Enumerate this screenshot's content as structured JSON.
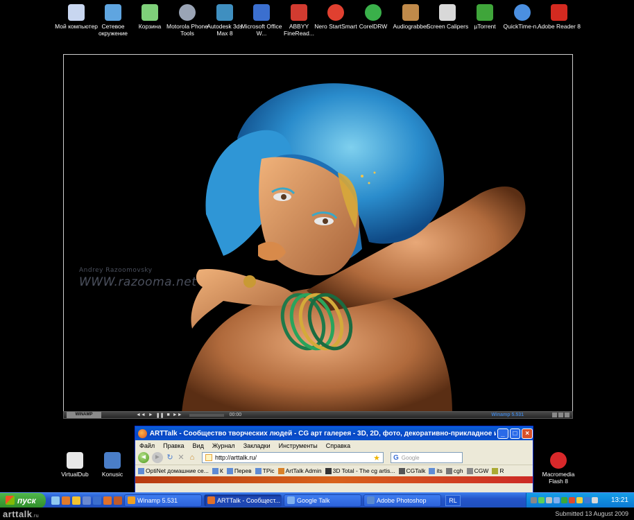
{
  "desktop_icons_top": [
    {
      "label": "Мой компьютер",
      "icon": "my-computer-icon",
      "color": "#c8d6f0"
    },
    {
      "label": "Сетевое окружение",
      "icon": "network-icon",
      "color": "#5fa5e0"
    },
    {
      "label": "Корзина",
      "icon": "recycle-bin-icon",
      "color": "#7fd07a"
    },
    {
      "label": "Motorola Phone Tools",
      "icon": "motorola-icon",
      "color": "#9aa4b5"
    },
    {
      "label": "Autodesk 3ds Max 8",
      "icon": "3dsmax-icon",
      "color": "#3f8fc0"
    },
    {
      "label": "Microsoft Office W...",
      "icon": "word-icon",
      "color": "#3b6fcf"
    },
    {
      "label": "ABBYY FineRead...",
      "icon": "abbyy-icon",
      "color": "#d23b30"
    },
    {
      "label": "Nero StartSmart",
      "icon": "nero-icon",
      "color": "#e04030"
    },
    {
      "label": "CorelDRW",
      "icon": "coreldraw-icon",
      "color": "#3ab04a"
    },
    {
      "label": "Audiograbber",
      "icon": "audiograbber-icon",
      "color": "#c08a4a"
    },
    {
      "label": "Screen Calipers",
      "icon": "screen-calipers-icon",
      "color": "#d8d8d8"
    },
    {
      "label": "µTorrent",
      "icon": "utorrent-icon",
      "color": "#3fa53a"
    },
    {
      "label": "QuickTime-n...",
      "icon": "quicktime-icon",
      "color": "#4b8fe0"
    },
    {
      "label": "Adobe Reader 8",
      "icon": "adobe-reader-icon",
      "color": "#d42a20"
    }
  ],
  "desktop_icons_bottom": [
    {
      "label": "VirtualDub",
      "icon": "virtualdub-icon",
      "color": "#e8e8e8"
    },
    {
      "label": "Konusic",
      "icon": "konusic-icon",
      "color": "#4a7ec8"
    },
    {
      "label": "Macromedia Flash 8",
      "icon": "flash-icon",
      "color": "#d8282a"
    }
  ],
  "photo": {
    "watermark_name": "Andrey Razoomovsky",
    "watermark_url": "WWW.razooma.net"
  },
  "winamp": {
    "logo": "WINAMP",
    "controls": [
      "◄◄",
      "►",
      "❚❚",
      "■",
      "►►"
    ],
    "time": "00:00",
    "title": "Winamp 5.531"
  },
  "browser": {
    "title": "ARTTalk - Сообщество творческих людей - CG арт галерея - 3D, 2D, фото, декоративно-прикладное искусст...",
    "menu": [
      "Файл",
      "Правка",
      "Вид",
      "Журнал",
      "Закладки",
      "Инструменты",
      "Справка"
    ],
    "url": "http://arttalk.ru/",
    "search_placeholder": "Google",
    "bookmarks": [
      "OptiNet домашние се...",
      "К",
      "Перев",
      "TPic",
      "ArtTalk Admin",
      "3D Total - The cg artis...",
      "CGTalk",
      "its",
      "cgh",
      "CGW",
      "R"
    ]
  },
  "taskbar": {
    "start_label": "пуск",
    "tasks": [
      {
        "label": "Winamp 5.531",
        "color": "#f0a020",
        "active": false
      },
      {
        "label": "ARTTalk - Сообщест...",
        "color": "#e0702a",
        "active": true
      },
      {
        "label": "Google Talk",
        "color": "#7fb0f0",
        "active": false
      },
      {
        "label": "Adobe Photoshop",
        "color": "#5a8ad0",
        "active": false
      }
    ],
    "lang": "RL",
    "clock": "13:21"
  },
  "footer": {
    "logo": "arttalk",
    "logo_suffix": ".ru",
    "submitted": "Submitted 13 August 2009"
  }
}
